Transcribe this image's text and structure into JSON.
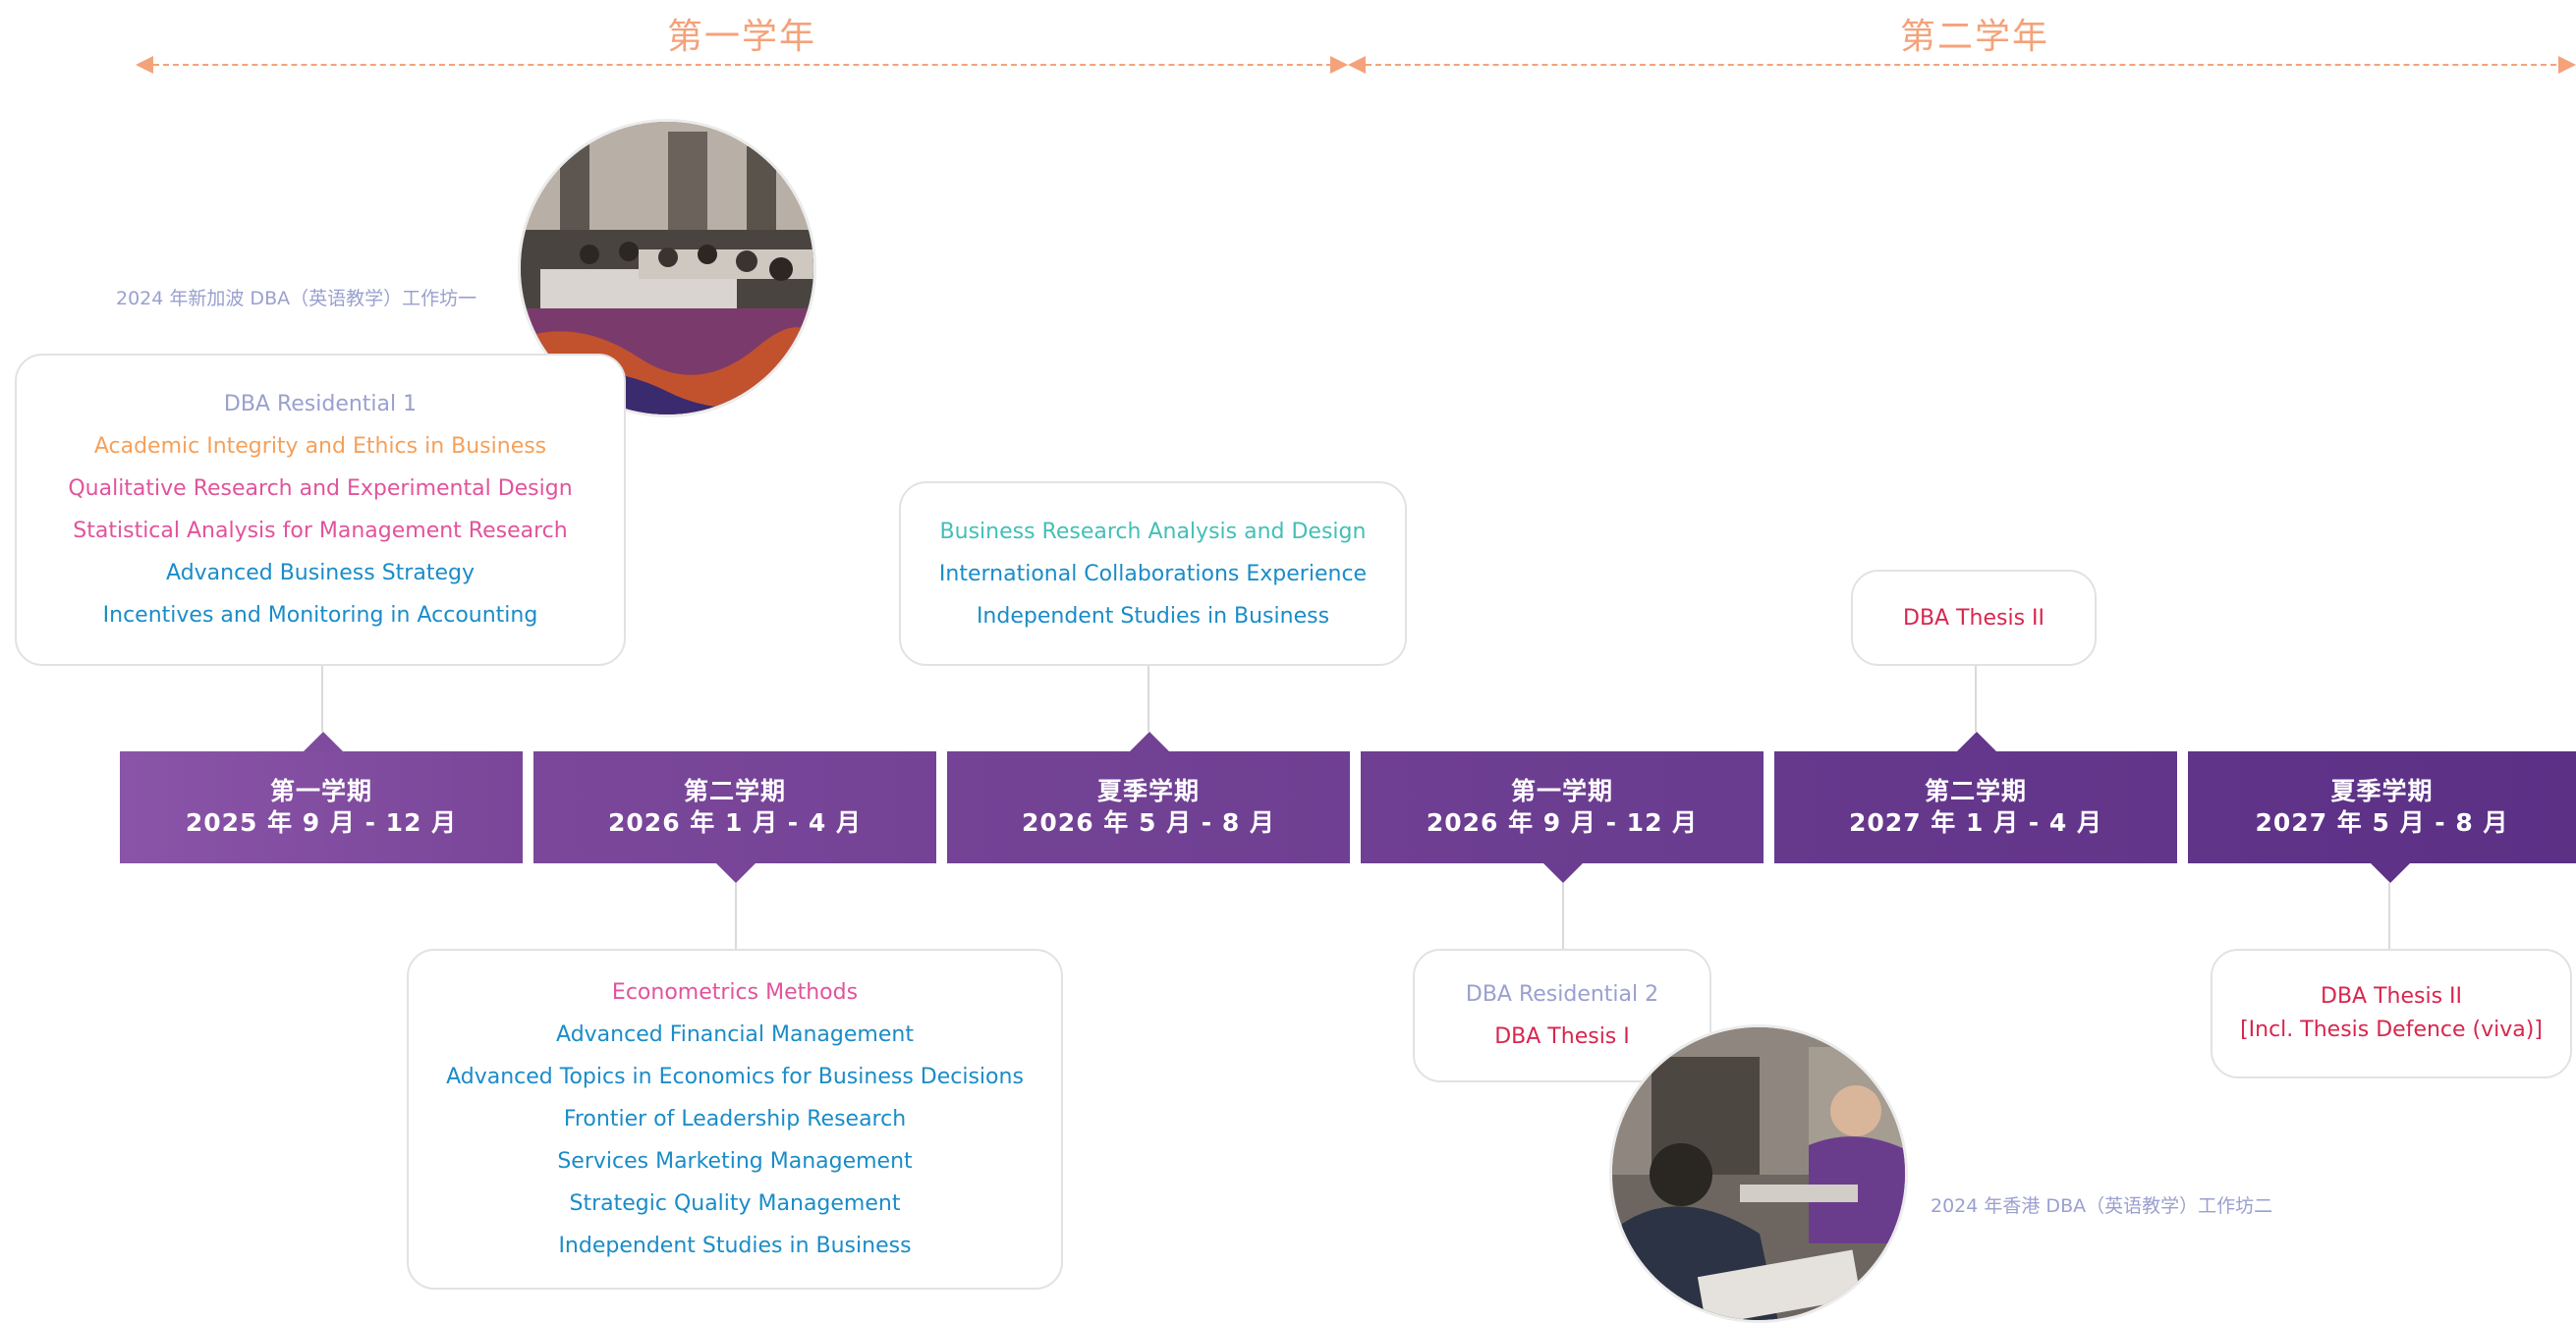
{
  "years": {
    "year1": "第一学年",
    "year2": "第二学年"
  },
  "colors": {
    "accent_orange": "#f4a27a",
    "semester_purple": "#6b3a91",
    "pink": "#e2539b",
    "blue": "#1a8cc8",
    "teal": "#43bfb6",
    "red": "#d8264e",
    "lavender": "#9aa0cf"
  },
  "semesters": [
    {
      "term": "第一学期",
      "dates": "2025 年 9 月 - 12 月"
    },
    {
      "term": "第二学期",
      "dates": "2026 年 1 月 - 4 月"
    },
    {
      "term": "夏季学期",
      "dates": "2026 年 5 月 - 8 月"
    },
    {
      "term": "第一学期",
      "dates": "2026 年 9 月 - 12 月"
    },
    {
      "term": "第二学期",
      "dates": "2027 年 1 月 - 4 月"
    },
    {
      "term": "夏季学期",
      "dates": "2027 年 5 月 - 8 月"
    }
  ],
  "cards": {
    "sem1": [
      "DBA Residential 1",
      "Academic Integrity and Ethics in Business",
      "Qualitative Research and Experimental Design",
      "Statistical Analysis for Management Research",
      "Advanced Business Strategy",
      "Incentives and Monitoring in Accounting"
    ],
    "sem2": [
      "Econometrics Methods",
      "Advanced Financial Management",
      "Advanced Topics in Economics for Business Decisions",
      "Frontier of Leadership Research",
      "Services Marketing Management",
      "Strategic Quality Management",
      "Independent Studies in Business"
    ],
    "sem3": [
      "Business Research Analysis and Design",
      "International Collaborations Experience",
      "Independent Studies in Business"
    ],
    "sem4": [
      "DBA Residential 2",
      "DBA Thesis I"
    ],
    "sem5": [
      "DBA Thesis II"
    ],
    "sem6": [
      "DBA Thesis II",
      "[Incl. Thesis Defence (viva)]"
    ]
  },
  "photos": {
    "caption1": "2024 年新加波 DBA（英语教学）工作坊一",
    "caption2": "2024 年香港 DBA（英语教学）工作坊二"
  }
}
